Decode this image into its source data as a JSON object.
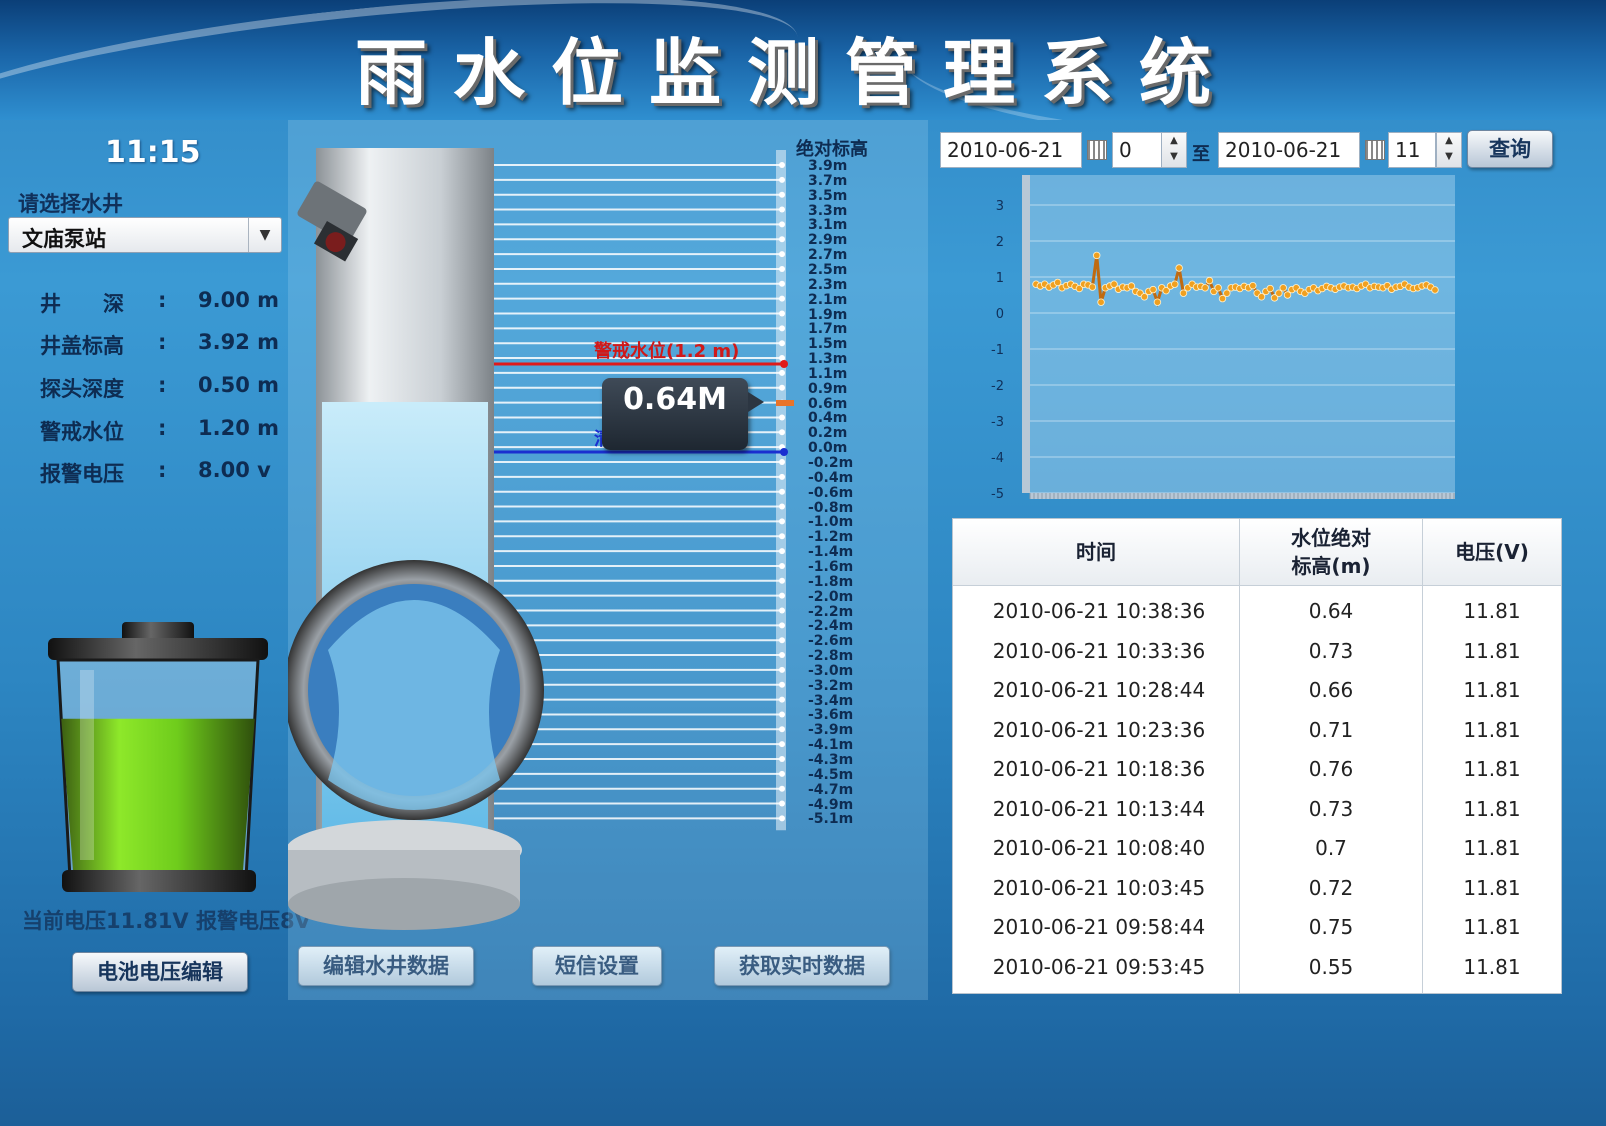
{
  "app_title": "雨水位监测管理系统",
  "clock": "11:15",
  "well_select": {
    "label": "请选择水井",
    "value": "文庙泵站"
  },
  "well_info": [
    {
      "key": "井　　深",
      "sep": ":",
      "value": "9.00 m"
    },
    {
      "key": "井盖标高",
      "sep": ":",
      "value": "3.92 m"
    },
    {
      "key": "探头深度",
      "sep": ":",
      "value": "0.50 m"
    },
    {
      "key": "警戒水位",
      "sep": ":",
      "value": "1.20 m"
    },
    {
      "key": "报警电压",
      "sep": ":",
      "value": "8.00 v"
    }
  ],
  "battery": {
    "status_text": "当前电压11.81V 报警电压8V",
    "fill_level": 0.72,
    "fill_color": "#7ed321"
  },
  "buttons": {
    "battery_edit": "电池电压编辑",
    "edit_well": "编辑水井数据",
    "sms": "短信设置",
    "realtime": "获取实时数据"
  },
  "gauge": {
    "scale_header": "绝对标高",
    "ticks": [
      "3.9m",
      "3.7m",
      "3.5m",
      "3.3m",
      "3.1m",
      "2.9m",
      "2.7m",
      "2.5m",
      "2.3m",
      "2.1m",
      "1.9m",
      "1.7m",
      "1.5m",
      "1.3m",
      "1.1m",
      "0.9m",
      "0.6m",
      "0.4m",
      "0.2m",
      "0.0m",
      "-0.2m",
      "-0.4m",
      "-0.6m",
      "-0.8m",
      "-1.0m",
      "-1.2m",
      "-1.4m",
      "-1.6m",
      "-1.8m",
      "-2.0m",
      "-2.2m",
      "-2.4m",
      "-2.6m",
      "-2.8m",
      "-3.0m",
      "-3.2m",
      "-3.4m",
      "-3.6m",
      "-3.9m",
      "-4.1m",
      "-4.3m",
      "-4.5m",
      "-4.7m",
      "-4.9m",
      "-5.1m"
    ],
    "warning_label": "警戒水位(1.2 m)",
    "current_value": "0.64M",
    "probe_label": "清",
    "water_color": "#9fdcf5"
  },
  "query": {
    "start_date": "2010-06-21",
    "start_hour": "0",
    "to_label": "至",
    "end_date": "2010-06-21",
    "end_hour": "11",
    "button": "查询"
  },
  "chart_data": {
    "type": "line",
    "title": "",
    "xlabel": "",
    "ylabel": "",
    "ylim": [
      -5,
      3
    ],
    "yticks": [
      "3",
      "2",
      "1",
      "0",
      "-1",
      "-2",
      "-3",
      "-4",
      "-5"
    ],
    "grid": true,
    "series": [
      {
        "color": "#f0a020",
        "values": [
          0.8,
          0.75,
          0.8,
          0.72,
          0.78,
          0.85,
          0.7,
          0.76,
          0.8,
          0.74,
          0.68,
          0.8,
          0.78,
          0.72,
          1.6,
          0.3,
          0.7,
          0.75,
          0.8,
          0.66,
          0.72,
          0.7,
          0.75,
          0.6,
          0.55,
          0.45,
          0.6,
          0.65,
          0.3,
          0.7,
          0.62,
          0.75,
          0.8,
          1.25,
          0.55,
          0.7,
          0.8,
          0.72,
          0.74,
          0.7,
          0.9,
          0.6,
          0.7,
          0.4,
          0.55,
          0.7,
          0.72,
          0.68,
          0.74,
          0.7,
          0.76,
          0.55,
          0.45,
          0.6,
          0.68,
          0.42,
          0.55,
          0.7,
          0.5,
          0.65,
          0.7,
          0.6,
          0.55,
          0.65,
          0.7,
          0.62,
          0.68,
          0.74,
          0.7,
          0.66,
          0.72,
          0.75,
          0.7,
          0.72,
          0.68,
          0.75,
          0.8,
          0.7,
          0.74,
          0.72,
          0.7,
          0.76,
          0.66,
          0.72,
          0.74,
          0.8,
          0.72,
          0.68,
          0.7,
          0.75,
          0.78,
          0.72,
          0.64
        ]
      }
    ]
  },
  "table": {
    "headers": [
      "时间",
      "水位绝对\n标高(m)",
      "电压(V)"
    ],
    "rows": [
      [
        "2010-06-21 10:38:36",
        "0.64",
        "11.81"
      ],
      [
        "2010-06-21 10:33:36",
        "0.73",
        "11.81"
      ],
      [
        "2010-06-21 10:28:44",
        "0.66",
        "11.81"
      ],
      [
        "2010-06-21 10:23:36",
        "0.71",
        "11.81"
      ],
      [
        "2010-06-21 10:18:36",
        "0.76",
        "11.81"
      ],
      [
        "2010-06-21 10:13:44",
        "0.73",
        "11.81"
      ],
      [
        "2010-06-21 10:08:40",
        "0.7",
        "11.81"
      ],
      [
        "2010-06-21 10:03:45",
        "0.72",
        "11.81"
      ],
      [
        "2010-06-21 09:58:44",
        "0.75",
        "11.81"
      ],
      [
        "2010-06-21 09:53:45",
        "0.55",
        "11.81"
      ]
    ]
  }
}
